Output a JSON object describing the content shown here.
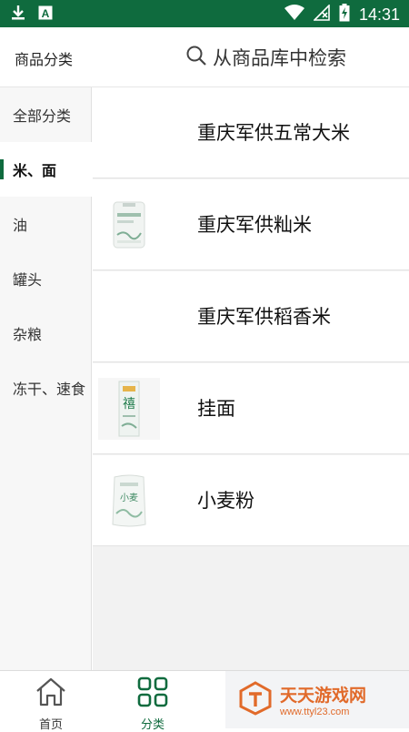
{
  "status_bar": {
    "time": "14:31",
    "icons": [
      "download-icon",
      "a-notification-icon",
      "wifi-icon",
      "signal-icon",
      "battery-charging-icon"
    ]
  },
  "header": {
    "title": "商品分类",
    "search_placeholder": "从商品库中检索"
  },
  "sidebar": {
    "items": [
      {
        "label": "全部分类",
        "active": false
      },
      {
        "label": "米、面",
        "active": true
      },
      {
        "label": "油",
        "active": false
      },
      {
        "label": "罐头",
        "active": false
      },
      {
        "label": "杂粮",
        "active": false
      },
      {
        "label": "冻干、速食",
        "active": false
      }
    ]
  },
  "products": [
    {
      "name": "重庆军供五常大米",
      "image": "none"
    },
    {
      "name": "重庆军供籼米",
      "image": "rice-bag"
    },
    {
      "name": "重庆军供稻香米",
      "image": "none"
    },
    {
      "name": "挂面",
      "image": "noodle-box"
    },
    {
      "name": "小麦粉",
      "image": "flour-bag"
    }
  ],
  "tabbar": {
    "tabs": [
      {
        "label": "首页",
        "icon": "home-icon",
        "active": false
      },
      {
        "label": "分类",
        "icon": "grid-icon",
        "active": true
      }
    ]
  },
  "watermark": {
    "main": "天天游戏网",
    "sub": "www.ttyl23.com"
  },
  "colors": {
    "accent": "#0f6b3e",
    "status_bar": "#0f6b3e",
    "watermark": "#e16a2a"
  }
}
